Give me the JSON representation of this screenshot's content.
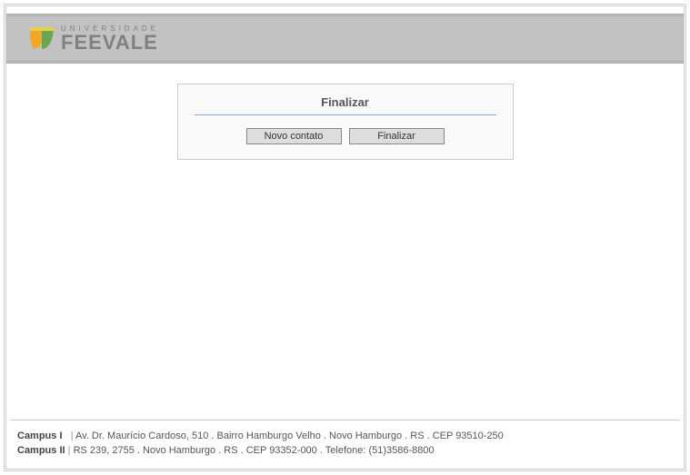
{
  "logo": {
    "top": "UNIVERSIDADE",
    "bottom": "FEEVALE"
  },
  "panel": {
    "title": "Finalizar",
    "btn_novo": "Novo contato",
    "btn_finalizar": "Finalizar"
  },
  "footer": {
    "campus1_label": "Campus I",
    "campus1_text": "Av. Dr. Maurício Cardoso, 510  .  Bairro Hamburgo Velho  .  Novo Hamburgo  .  RS  .  CEP 93510-250",
    "campus2_label": "Campus II",
    "campus2_text": "RS 239, 2755  .  Novo Hamburgo  .  RS  .  CEP 93352-000  .  Telefone: (51)3586-8800",
    "sep": "|"
  }
}
